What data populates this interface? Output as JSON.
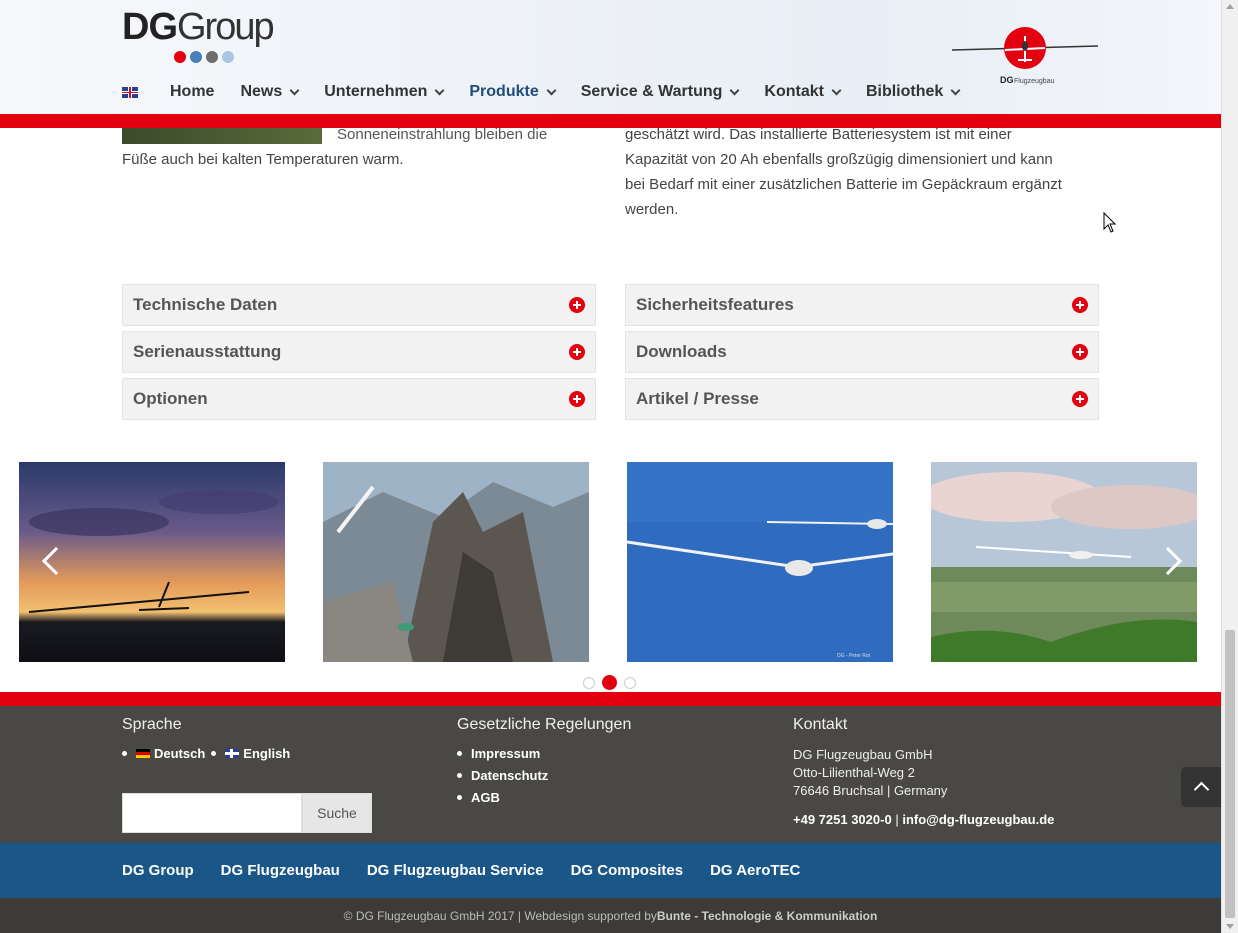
{
  "header": {
    "logo_text_bold": "DG",
    "logo_text_light": "Group",
    "logo_dot_colors": [
      "#e3000f",
      "#4a7fb8",
      "#6d6d6d",
      "#a9c6e3"
    ],
    "nav": [
      {
        "label": "Home",
        "dropdown": false,
        "active": false
      },
      {
        "label": "News",
        "dropdown": true,
        "active": false
      },
      {
        "label": "Unternehmen",
        "dropdown": true,
        "active": false
      },
      {
        "label": "Produkte",
        "dropdown": true,
        "active": true
      },
      {
        "label": "Service & Wartung",
        "dropdown": true,
        "active": false
      },
      {
        "label": "Kontakt",
        "dropdown": true,
        "active": false
      },
      {
        "label": "Bibliothek",
        "dropdown": true,
        "active": false
      }
    ],
    "brand_logo_text": "DG Flugzeugbau"
  },
  "content": {
    "left_line1": "Sonneneinstrahlung bleiben die",
    "left_line2": "Füße auch bei kalten Temperaturen warm.",
    "right_line1": "geschätzt wird. Das installierte Batteriesystem ist mit einer",
    "right_line2": "Kapazität von 20 Ah ebenfalls großzügig dimensioniert und kann",
    "right_line3": "bei Bedarf mit einer zusätzlichen Batterie im Gepäckraum ergänzt",
    "right_line4": "werden."
  },
  "accordions": {
    "left": [
      "Technische Daten",
      "Serienausstattung",
      "Optionen"
    ],
    "right": [
      "Sicherheitsfeatures",
      "Downloads",
      "Artikel / Presse"
    ]
  },
  "slider": {
    "slides": [
      "sunset-glider",
      "mountain-glider",
      "two-gliders-sky",
      "glider-landscape"
    ],
    "active_dot": 2,
    "dot_count": 3,
    "slide3_caption": "DG - Peter Rot"
  },
  "footer": {
    "sprache_title": "Sprache",
    "lang_de": "Deutsch",
    "lang_en": "English",
    "search_placeholder": "",
    "search_button": "Suche",
    "legal_title": "Gesetzliche Regelungen",
    "legal_links": [
      "Impressum",
      "Datenschutz",
      "AGB"
    ],
    "contact_title": "Kontakt",
    "company": "DG Flugzeugbau GmbH",
    "street": "Otto-Lilienthal-Weg 2",
    "city": "76646 Bruchsal | Germany",
    "phone": "+49 7251 3020-0",
    "separator": "|",
    "email": "info@dg-flugzeugbau.de"
  },
  "bottom_links": [
    "DG Group",
    "DG Flugzeugbau",
    "DG Flugzeugbau Service",
    "DG Composites",
    "DG AeroTEC"
  ],
  "copyright": {
    "text": "© DG Flugzeugbau GmbH 2017 | Webdesign supported by",
    "link": "Bunte - Technologie & Kommunikation"
  },
  "colors": {
    "brand_red": "#e3000f",
    "nav_active": "#1e4e79",
    "footer_bg": "#4a4844",
    "blue_bar": "#1a5788"
  }
}
